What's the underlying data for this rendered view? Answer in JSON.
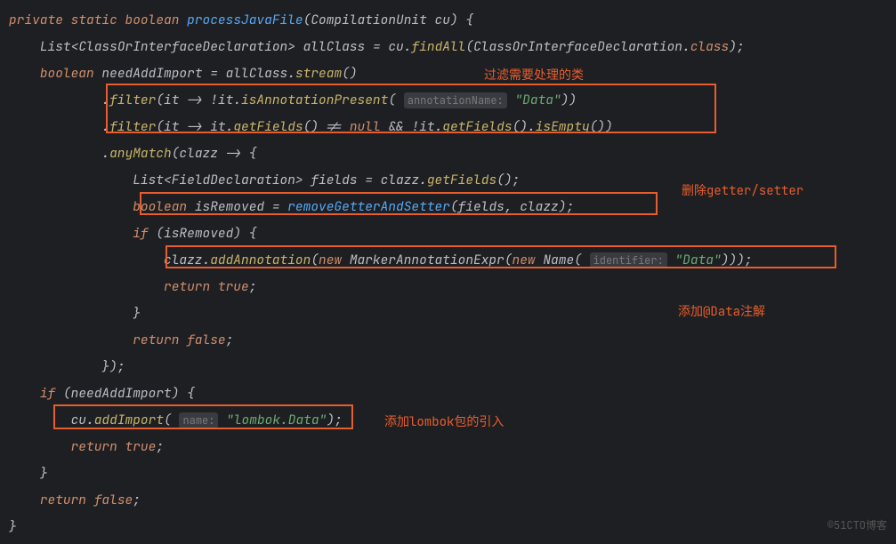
{
  "code": {
    "l1": {
      "kw1": "private",
      "kw2": "static",
      "kw3": "boolean",
      "name": "processJavaFile",
      "paramType": "CompilationUnit",
      "paramName": "cu",
      "brace": ") {"
    },
    "l2": {
      "type1": "List",
      "type2": "ClassOrInterfaceDeclaration",
      "var": "allClass",
      "eq": " = ",
      "obj": "cu",
      "dot": ".",
      "call": "findAll",
      "paren": "(",
      "arg": "ClassOrInterfaceDeclaration",
      "dot2": ".",
      "cls": "class",
      "end": ");"
    },
    "l3": {
      "kw": "boolean",
      "var": "needAddImport",
      "eq": " = ",
      "obj": "allClass",
      "dot": ".",
      "call": "stream",
      "end": "()"
    },
    "l4": {
      "dot": ".",
      "call": "filter",
      "open": "(",
      "p": "it",
      "arrow": " -> !",
      "obj": "it",
      "d2": ".",
      "m2": "isAnnotationPresent",
      "o2": "(",
      "hint": "annotationName:",
      "str": "\"Data\"",
      "end": "))"
    },
    "l5": {
      "dot": ".",
      "call": "filter",
      "open": "(",
      "p": "it",
      "arrow": " -> ",
      "obj": "it",
      "d2": ".",
      "m2": "getFields",
      "mid": "() != ",
      "nul": "null",
      "and": " && !",
      "obj2": "it",
      "d3": ".",
      "m3": "getFields",
      "d4": "().",
      "m4": "isEmpty",
      "end": "())"
    },
    "l6": {
      "dot": ".",
      "call": "anyMatch",
      "open": "(",
      "p": "clazz",
      "arrow": " -> {"
    },
    "l7": {
      "type1": "List",
      "type2": "FieldDeclaration",
      "close": ">",
      "var": "fields",
      "eq": " = ",
      "obj": "clazz",
      "d": ".",
      "m": "getFields",
      "end": "();"
    },
    "l8": {
      "kw": "boolean",
      "var": "isRemoved",
      "eq": " = ",
      "call": "removeGetterAndSetter",
      "open": "(",
      "a1": "fields",
      "c": ", ",
      "a2": "clazz",
      "end": ");"
    },
    "l9": {
      "kw": "if",
      "open": " (",
      "var": "isRemoved",
      "end": ") {"
    },
    "l10": {
      "obj": "clazz",
      "d": ".",
      "m": "addAnnotation",
      "o": "(",
      "kw": "new",
      "sp": " ",
      "cls": "MarkerAnnotationExpr",
      "o2": "(",
      "kw2": "new",
      "sp2": " ",
      "cls2": "Name",
      "o3": "(",
      "hint": "identifier:",
      "str": "\"Data\"",
      "end": ")));"
    },
    "l11": {
      "kw": "return",
      "sp": " ",
      "val": "true",
      "end": ";"
    },
    "l12": {
      "brace": "}"
    },
    "l13": {
      "kw": "return",
      "sp": " ",
      "val": "false",
      "end": ";"
    },
    "l14": {
      "end": "});"
    },
    "l15": {
      "kw": "if",
      "open": " (",
      "var": "needAddImport",
      "end": ") {"
    },
    "l16": {
      "obj": "cu",
      "d": ".",
      "m": "addImport",
      "o": "(",
      "hint": "name:",
      "str": "\"lombok.Data\"",
      "end": ");"
    },
    "l17": {
      "kw": "return",
      "sp": " ",
      "val": "true",
      "end": ";"
    },
    "l18": {
      "brace": "}"
    },
    "l19": {
      "kw": "return",
      "sp": " ",
      "val": "false",
      "end": ";"
    },
    "l20": {
      "brace": "}"
    }
  },
  "annotations": {
    "a1": "过滤需要处理的类",
    "a2": "删除getter/setter",
    "a3": "添加@Data注解",
    "a4": "添加lombok包的引入"
  },
  "watermark": "©51CTO博客"
}
